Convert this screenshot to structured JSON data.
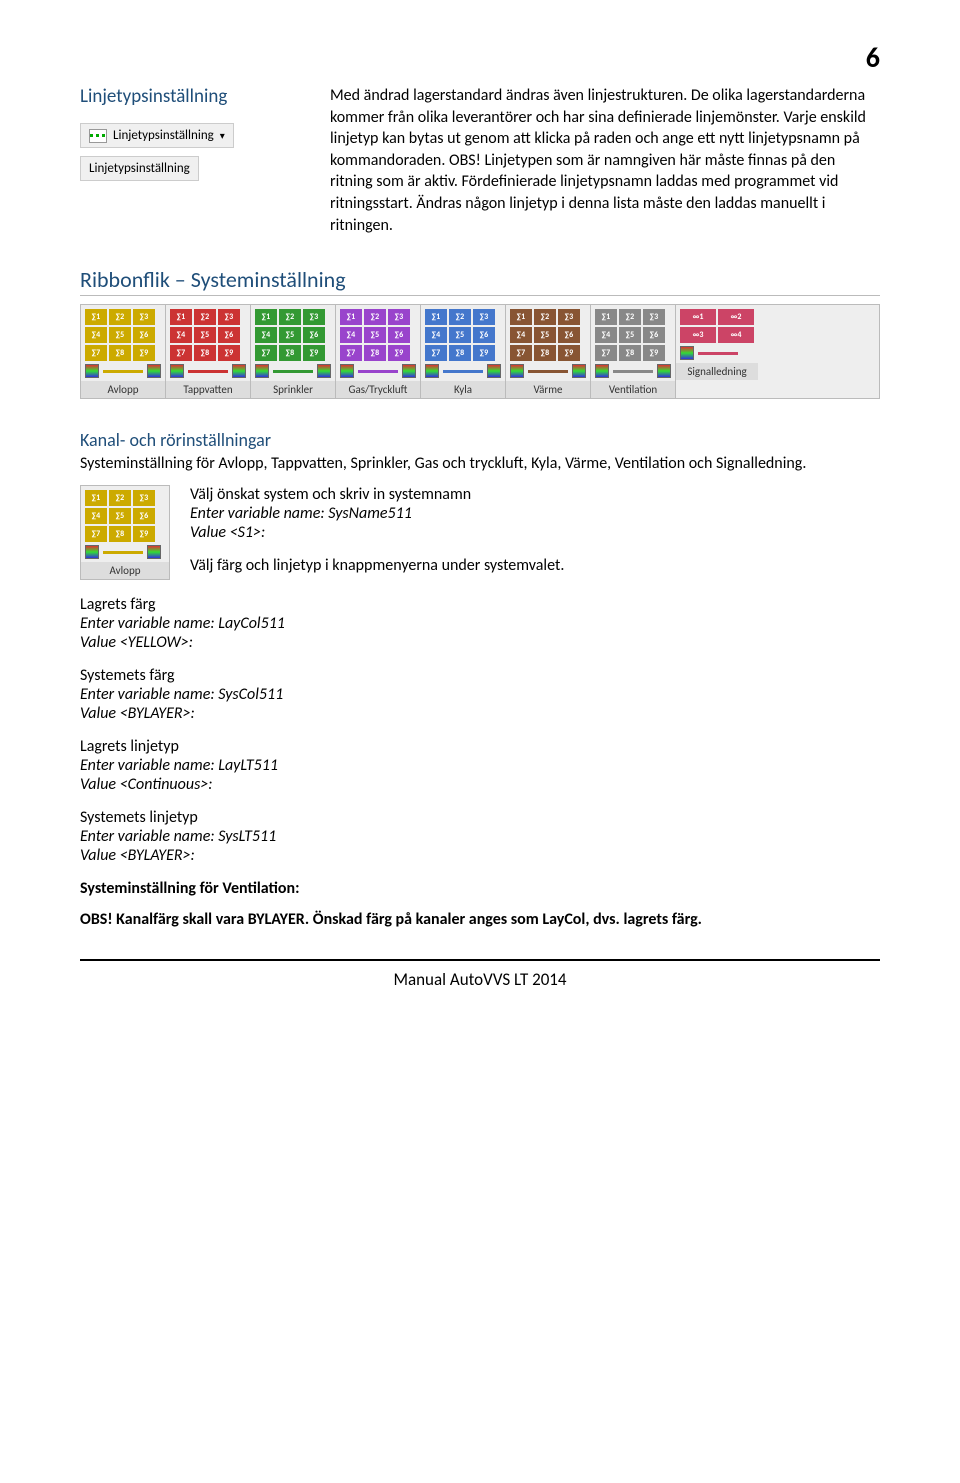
{
  "page_number": "6",
  "sidebar": {
    "heading": "Linjetypsinställning",
    "button_label": "Linjetypsinställning",
    "label": "Linjetypsinställning"
  },
  "intro_paragraph": "Med ändrad lagerstandard ändras även linjestrukturen. De olika lagerstandarderna kommer från olika leverantörer och har sina definierade linjemönster. Varje enskild linjetyp kan bytas ut genom att klicka på raden och ange ett nytt linjetypsnamn på kommandoraden. OBS! Linjetypen som är namngiven här måste finnas på den ritning som är aktiv. Fördefinierade linjetypsnamn laddas med programmet vid ritningsstart. Ändras någon linjetyp i denna lista måste den laddas manuellt i ritningen.",
  "section_heading": "Ribbonflik – Systeminställning",
  "ribbon_panels": [
    {
      "label": "Avlopp",
      "color": "c-yellow"
    },
    {
      "label": "Tappvatten",
      "color": "c-red"
    },
    {
      "label": "Sprinkler",
      "color": "c-green"
    },
    {
      "label": "Gas/Tryckluft",
      "color": "c-purple"
    },
    {
      "label": "Kyla",
      "color": "c-blue"
    },
    {
      "label": "Värme",
      "color": "c-brown"
    },
    {
      "label": "Ventilation",
      "color": "c-gray"
    },
    {
      "label": "Signalledning",
      "color": "c-pink",
      "two": true
    }
  ],
  "sub_heading": "Kanal- och rörinställningar",
  "sub_text": "Systeminställning för Avlopp, Tappvatten, Sprinkler, Gas och tryckluft, Kyla, Värme, Ventilation och Signalledning.",
  "mini_panel": {
    "label": "Avlopp",
    "color": "c-yellow"
  },
  "instructions": {
    "line1": "Välj önskat system och skriv in systemnamn",
    "line2": "Enter variable name: SysName511",
    "line3": "Value <S1>:",
    "line4": "Välj färg och linjetyp i knappmenyerna under systemvalet."
  },
  "blocks": [
    {
      "title": "Lagrets färg",
      "l1": "Enter variable name: LayCol511",
      "l2": "Value <YELLOW>:"
    },
    {
      "title": "Systemets färg",
      "l1": "Enter variable name: SysCol511",
      "l2": "Value <BYLAYER>:"
    },
    {
      "title": "Lagrets linjetyp",
      "l1": "Enter variable name: LayLT511",
      "l2": "Value <Continuous>:"
    },
    {
      "title": "Systemets linjetyp",
      "l1": "Enter variable name: SysLT511",
      "l2": "Value <BYLAYER>:"
    }
  ],
  "bold_line1": "Systeminställning för Ventilation:",
  "bold_line2": "OBS! Kanalfärg skall vara BYLAYER. Önskad färg på kanaler anges som LayCol, dvs. lagrets färg.",
  "footer": "Manual AutoVVS LT 2014"
}
